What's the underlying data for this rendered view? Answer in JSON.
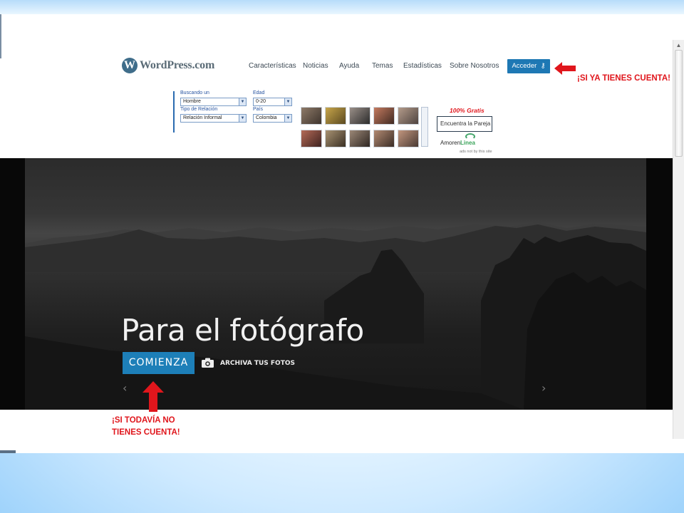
{
  "header": {
    "logo_text": "WordPress.com",
    "nav": [
      {
        "label": "Características"
      },
      {
        "label": "Noticias"
      },
      {
        "label": "Ayuda"
      },
      {
        "label": "Temas"
      },
      {
        "label": "Estadísticas"
      },
      {
        "label": "Sobre Nosotros"
      }
    ],
    "login_button": "Acceder"
  },
  "annotations": {
    "login_note": "¡SI YA TIENES CUENTA!",
    "signup_note_line1": "¡SI TODAVÍA NO",
    "signup_note_line2": "TIENES CUENTA!"
  },
  "ad": {
    "label_busco": "Buscando un",
    "select_busco": "Hombre",
    "label_edad": "Edad",
    "select_edad": "0-20",
    "label_tipo": "Tipo de Relación",
    "select_tipo": "Relación Informal",
    "label_pais": "País",
    "select_pais": "Colombia",
    "gratis": "100% Gratis",
    "input_value": "Encuentra la Pareja",
    "brand": "AmorenLinea.com",
    "brand_a": "Amoren",
    "brand_b": "Linea",
    "small_note": "ads not by this site"
  },
  "hero": {
    "title": "Para el fotógrafo",
    "cta_button": "COMIENZA",
    "secondary_link": "ARCHIVA TUS FOTOS",
    "prev_icon": "‹",
    "next_icon": "›"
  },
  "colors": {
    "accent_blue": "#1d7fb8",
    "annotation_red": "#e0161c"
  }
}
